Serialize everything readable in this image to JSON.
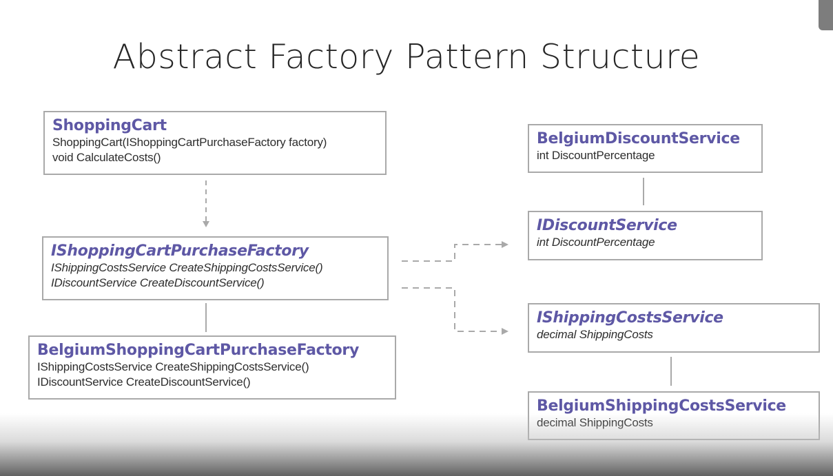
{
  "title": "Abstract Factory Pattern Structure",
  "boxes": {
    "shopping_cart": {
      "name": "ShoppingCart",
      "lines": [
        "ShoppingCart(IShoppingCartPurchaseFactory factory)",
        "void CalculateCosts()"
      ]
    },
    "ishopping_cart_purchase_factory": {
      "name": "IShoppingCartPurchaseFactory",
      "lines": [
        "IShippingCostsService CreateShippingCostsService()",
        "IDiscountService CreateDiscountService()"
      ]
    },
    "belgium_shopping_cart_purchase_factory": {
      "name": "BelgiumShoppingCartPurchaseFactory",
      "lines": [
        "IShippingCostsService CreateShippingCostsService()",
        "IDiscountService CreateDiscountService()"
      ]
    },
    "belgium_discount_service": {
      "name": "BelgiumDiscountService",
      "lines": [
        "int DiscountPercentage"
      ]
    },
    "idiscount_service": {
      "name": "IDiscountService",
      "lines": [
        "int DiscountPercentage"
      ]
    },
    "ishipping_costs_service": {
      "name": "IShippingCostsService",
      "lines": [
        "decimal ShippingCosts"
      ]
    },
    "belgium_shipping_costs_service": {
      "name": "BelgiumShippingCostsService",
      "lines": [
        "decimal ShippingCosts"
      ]
    }
  },
  "colors": {
    "class_name": "#5e58a5",
    "body_text": "#2d2d2d",
    "box_border": "#a9a9a9",
    "dashed_connector": "#a9a9a9",
    "solid_connector": "#a9a9a9",
    "title": "#262626"
  }
}
